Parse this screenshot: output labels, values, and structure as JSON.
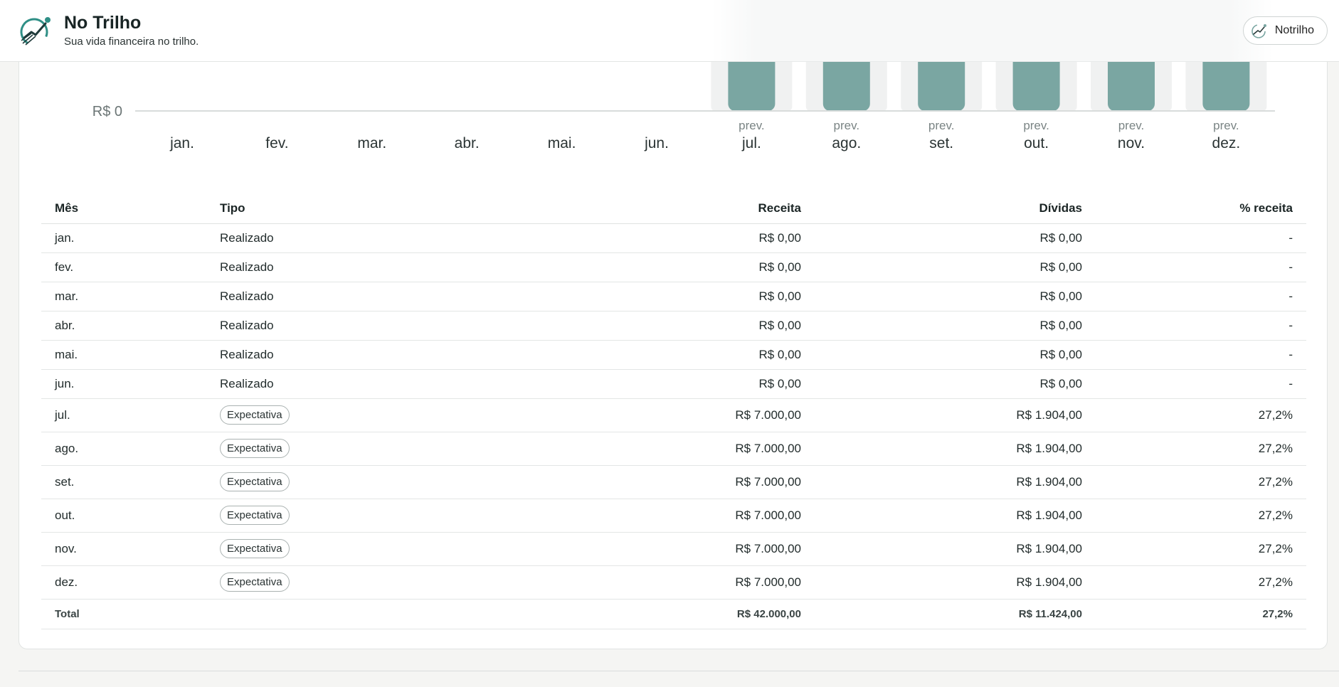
{
  "header": {
    "title": "No Trilho",
    "subtitle": "Sua vida financeira no trilho.",
    "user_label": "Notrilho",
    "logo_icon": "track-chart-logo-icon"
  },
  "colors": {
    "bar_forecast": "#7aa6a2",
    "bar_background": "#f0f1f1",
    "axis": "#d8dcdb",
    "text_muted": "#7a8484"
  },
  "chart_data": {
    "type": "bar",
    "y_tick_label": "R$ 0",
    "categories": [
      "jan.",
      "fev.",
      "mar.",
      "abr.",
      "mai.",
      "jun.",
      "jul.",
      "ago.",
      "set.",
      "out.",
      "nov.",
      "dez."
    ],
    "forecast_prefix": [
      "",
      "",
      "",
      "",
      "",
      "",
      "prev.",
      "prev.",
      "prev.",
      "prev.",
      "prev.",
      "prev."
    ],
    "series": [
      {
        "values": [
          0,
          0,
          0,
          0,
          0,
          0,
          7000,
          7000,
          7000,
          7000,
          7000,
          7000
        ]
      }
    ],
    "visible_top_fraction": 0.24
  },
  "table": {
    "headers": [
      "Mês",
      "Tipo",
      "Receita",
      "Dívidas",
      "% receita"
    ],
    "rows": [
      {
        "month": "jan.",
        "type": "Realizado",
        "badge": false,
        "revenue": "R$ 0,00",
        "debts": "R$ 0,00",
        "pct": "-"
      },
      {
        "month": "fev.",
        "type": "Realizado",
        "badge": false,
        "revenue": "R$ 0,00",
        "debts": "R$ 0,00",
        "pct": "-"
      },
      {
        "month": "mar.",
        "type": "Realizado",
        "badge": false,
        "revenue": "R$ 0,00",
        "debts": "R$ 0,00",
        "pct": "-"
      },
      {
        "month": "abr.",
        "type": "Realizado",
        "badge": false,
        "revenue": "R$ 0,00",
        "debts": "R$ 0,00",
        "pct": "-"
      },
      {
        "month": "mai.",
        "type": "Realizado",
        "badge": false,
        "revenue": "R$ 0,00",
        "debts": "R$ 0,00",
        "pct": "-"
      },
      {
        "month": "jun.",
        "type": "Realizado",
        "badge": false,
        "revenue": "R$ 0,00",
        "debts": "R$ 0,00",
        "pct": "-"
      },
      {
        "month": "jul.",
        "type": "Expectativa",
        "badge": true,
        "revenue": "R$ 7.000,00",
        "debts": "R$ 1.904,00",
        "pct": "27,2%"
      },
      {
        "month": "ago.",
        "type": "Expectativa",
        "badge": true,
        "revenue": "R$ 7.000,00",
        "debts": "R$ 1.904,00",
        "pct": "27,2%"
      },
      {
        "month": "set.",
        "type": "Expectativa",
        "badge": true,
        "revenue": "R$ 7.000,00",
        "debts": "R$ 1.904,00",
        "pct": "27,2%"
      },
      {
        "month": "out.",
        "type": "Expectativa",
        "badge": true,
        "revenue": "R$ 7.000,00",
        "debts": "R$ 1.904,00",
        "pct": "27,2%"
      },
      {
        "month": "nov.",
        "type": "Expectativa",
        "badge": true,
        "revenue": "R$ 7.000,00",
        "debts": "R$ 1.904,00",
        "pct": "27,2%"
      },
      {
        "month": "dez.",
        "type": "Expectativa",
        "badge": true,
        "revenue": "R$ 7.000,00",
        "debts": "R$ 1.904,00",
        "pct": "27,2%"
      }
    ],
    "total": {
      "label": "Total",
      "revenue": "R$ 42.000,00",
      "debts": "R$ 11.424,00",
      "pct": "27,2%"
    }
  }
}
